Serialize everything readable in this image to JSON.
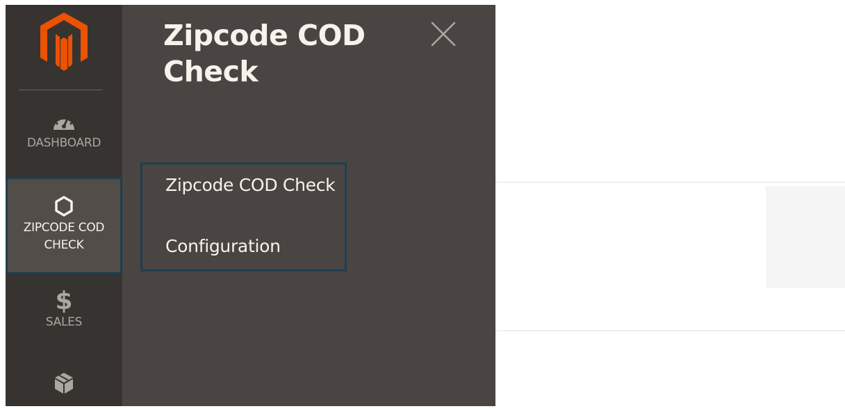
{
  "sidebar": {
    "logo_icon": "magento-logo-icon",
    "items": [
      {
        "label": "DASHBOARD",
        "icon": "dashboard-gauge-icon",
        "active": false
      },
      {
        "label": "ZIPCODE COD CHECK",
        "label_line1": "ZIPCODE COD",
        "label_line2": "CHECK",
        "icon": "hexagon-icon",
        "active": true
      },
      {
        "label": "SALES",
        "icon": "dollar-icon",
        "active": false
      },
      {
        "label": "",
        "icon": "box-icon",
        "active": false
      }
    ]
  },
  "flyout": {
    "title": "Zipcode COD Check",
    "close_icon": "close-icon",
    "links": [
      {
        "label": "Zipcode COD Check"
      },
      {
        "label": "Configuration"
      }
    ]
  },
  "colors": {
    "sidebar_bg": "#373330",
    "flyout_bg": "#4a4542",
    "active_item_bg": "#524d49",
    "focus_outline": "#1d3f50",
    "logo_orange": "#eb5202",
    "text_light": "#f7f3eb",
    "text_muted": "#aaa6a0"
  }
}
